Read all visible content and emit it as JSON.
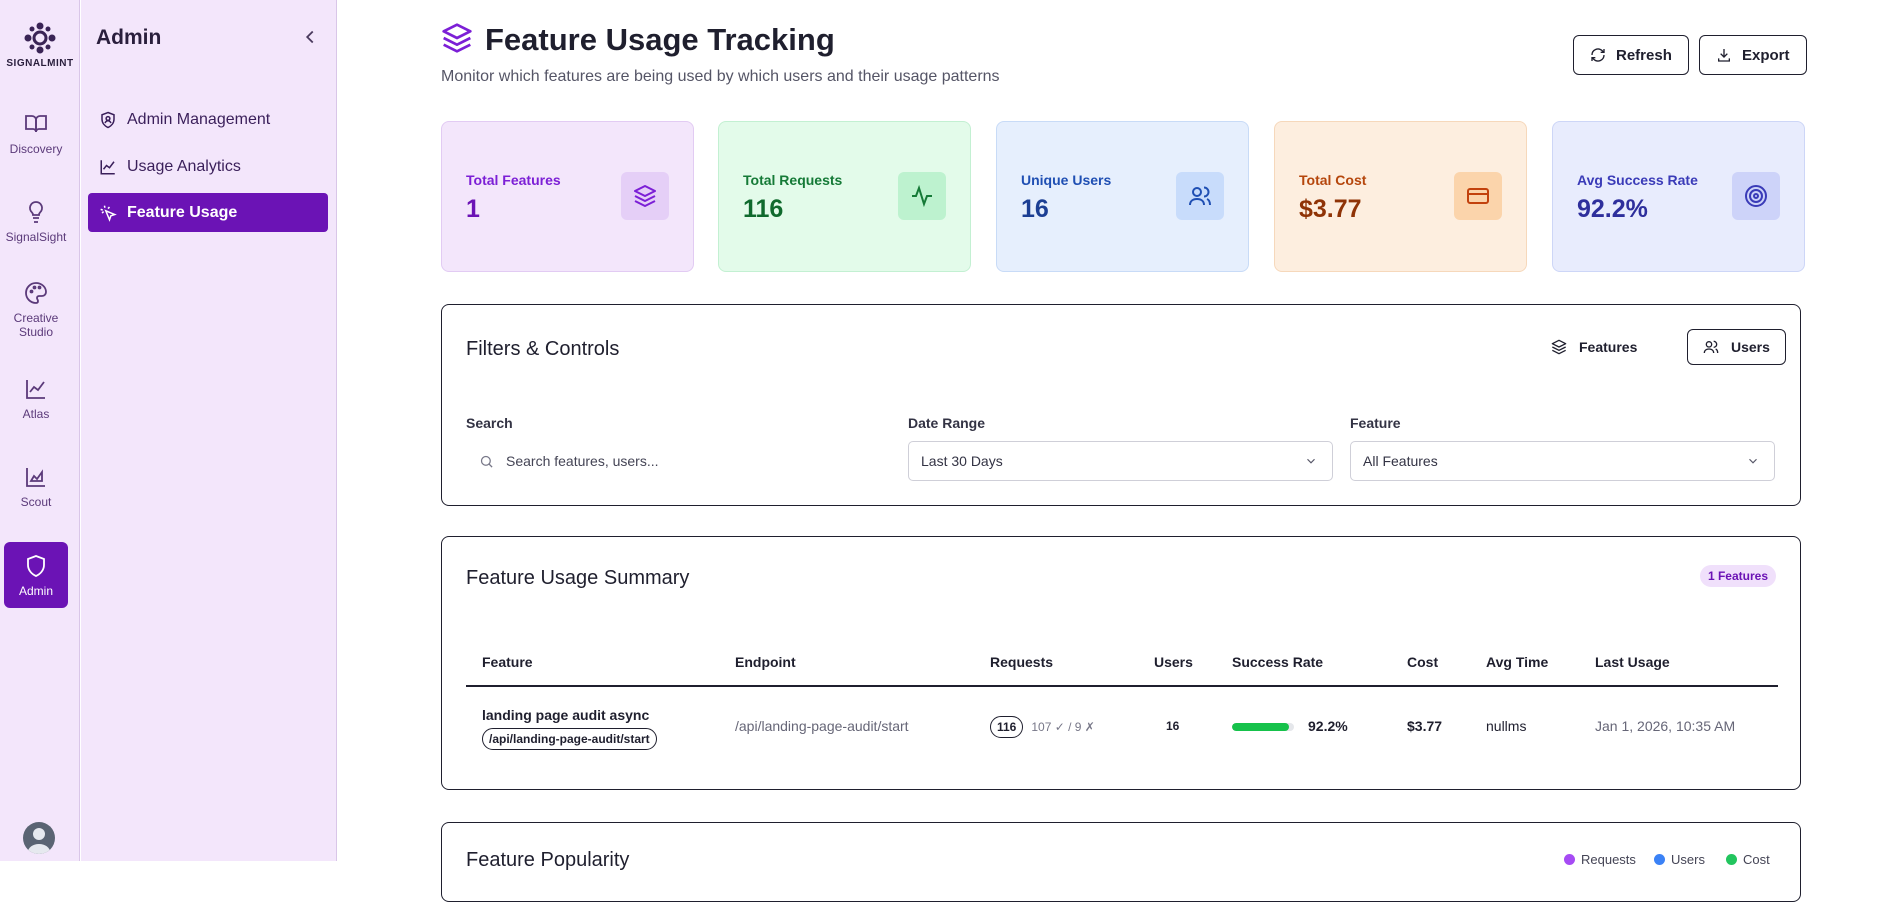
{
  "brand": {
    "name": "SIGNALMINT"
  },
  "rail": {
    "items": [
      {
        "label": "Discovery"
      },
      {
        "label": "SignalSight"
      },
      {
        "label": "Creative Studio"
      },
      {
        "label": "Atlas"
      },
      {
        "label": "Scout"
      },
      {
        "label": "Admin"
      }
    ]
  },
  "sidebar": {
    "title": "Admin",
    "items": [
      {
        "label": "Admin Management"
      },
      {
        "label": "Usage Analytics"
      },
      {
        "label": "Feature Usage"
      }
    ]
  },
  "header": {
    "title": "Feature Usage Tracking",
    "subtitle": "Monitor which features are being used by which users and their usage patterns",
    "refresh_label": "Refresh",
    "export_label": "Export"
  },
  "stats": [
    {
      "label": "Total Features",
      "value": "1",
      "icon": "layers-icon"
    },
    {
      "label": "Total Requests",
      "value": "116",
      "icon": "activity-icon"
    },
    {
      "label": "Unique Users",
      "value": "16",
      "icon": "users-icon"
    },
    {
      "label": "Total Cost",
      "value": "$3.77",
      "icon": "credit-card-icon"
    },
    {
      "label": "Avg Success Rate",
      "value": "92.2%",
      "icon": "target-icon"
    }
  ],
  "filters": {
    "title": "Filters & Controls",
    "toggle_features": "Features",
    "toggle_users": "Users",
    "search_label": "Search",
    "search_placeholder": "Search features, users...",
    "date_label": "Date Range",
    "date_value": "Last 30 Days",
    "feature_label": "Feature",
    "feature_value": "All Features"
  },
  "summary": {
    "title": "Feature Usage Summary",
    "badge": "1 Features",
    "columns": [
      "Feature",
      "Endpoint",
      "Requests",
      "Users",
      "Success Rate",
      "Cost",
      "Avg Time",
      "Last Usage"
    ],
    "rows": [
      {
        "feature": "landing page audit async",
        "feature_path": "/api/landing-page-audit/start",
        "endpoint": "/api/landing-page-audit/start",
        "requests": "116",
        "requests_detail": "107 ✓ / 9 ✗",
        "users": "16",
        "success_rate": "92.2%",
        "success_fraction": 0.922,
        "cost": "$3.77",
        "avg_time": "nullms",
        "last_usage": "Jan 1, 2026, 10:35 AM"
      }
    ]
  },
  "popularity": {
    "title": "Feature Popularity",
    "legend": [
      "Requests",
      "Users",
      "Cost"
    ]
  },
  "colors": {
    "accent": "#6b13b5",
    "sidebar_bg": "#f3e6fb",
    "success": "#16c24b"
  }
}
